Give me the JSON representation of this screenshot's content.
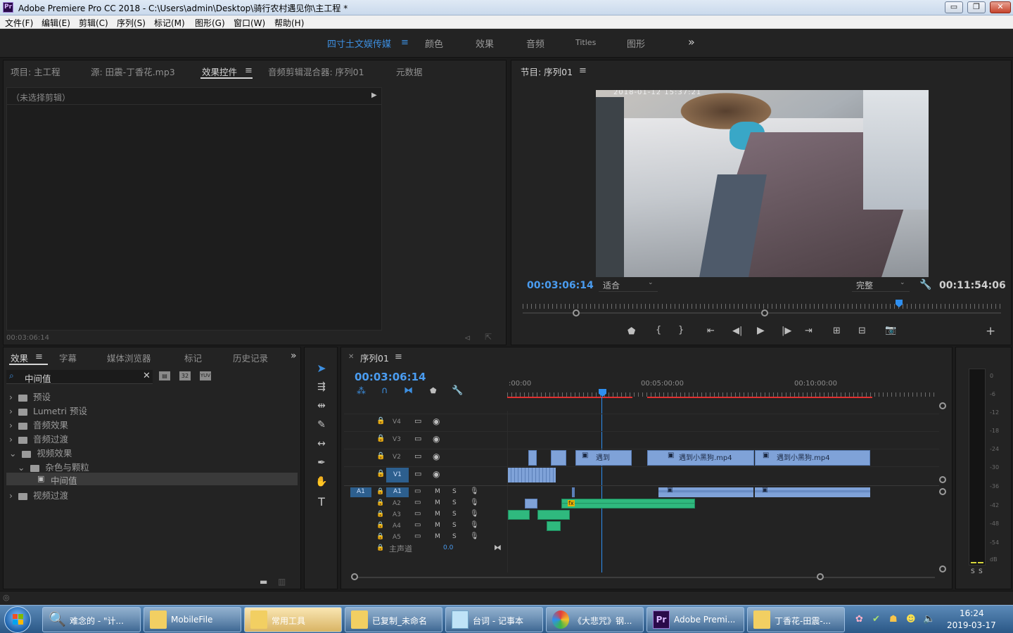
{
  "window": {
    "title": "Adobe Premiere Pro CC 2018 - C:\\Users\\admin\\Desktop\\骑行农村遇见你\\主工程 *",
    "app_icon": "Pr",
    "controls": {
      "minimize": "▭",
      "restore": "❐",
      "close": "✕"
    }
  },
  "menu": [
    "文件(F)",
    "编辑(E)",
    "剪辑(C)",
    "序列(S)",
    "标记(M)",
    "图形(G)",
    "窗口(W)",
    "帮助(H)"
  ],
  "workspaces": {
    "items": [
      "四寸土文娱传媒",
      "颜色",
      "效果",
      "音频",
      "Titles",
      "图形"
    ],
    "active_index": 0,
    "more": "»"
  },
  "source_panel": {
    "tabs": [
      "项目: 主工程",
      "源: 田震-丁香花.mp3",
      "效果控件",
      "音频剪辑混合器: 序列01",
      "元数据"
    ],
    "active_tab": "效果控件",
    "no_clip": "（未选择剪辑）",
    "timecode": "00:03:06:14"
  },
  "program_panel": {
    "title": "节目: 序列01",
    "video_timestamp": "2018-01-12 15:37:21",
    "timecode": "00:03:06:14",
    "fit_label": "适合",
    "quality_label": "完整",
    "duration": "00:11:54:06",
    "playhead_fraction": 0.78
  },
  "effects_panel": {
    "tabs": [
      "效果",
      "字幕",
      "媒体浏览器",
      "标记",
      "历史记录"
    ],
    "active_tab": "效果",
    "search_value": "中间值",
    "badges": [
      "32",
      "YUV"
    ],
    "tree": [
      {
        "label": "预设",
        "level": 0,
        "expanded": false
      },
      {
        "label": "Lumetri 预设",
        "level": 0,
        "expanded": false
      },
      {
        "label": "音频效果",
        "level": 0,
        "expanded": false
      },
      {
        "label": "音频过渡",
        "level": 0,
        "expanded": false
      },
      {
        "label": "视频效果",
        "level": 0,
        "expanded": true
      },
      {
        "label": "杂色与颗粒",
        "level": 1,
        "expanded": true
      },
      {
        "label": "中间值",
        "level": 2,
        "selected": true
      },
      {
        "label": "视频过渡",
        "level": 0,
        "expanded": false
      }
    ]
  },
  "timeline": {
    "sequence_name": "序列01",
    "timecode": "00:03:06:14",
    "ruler": [
      ":00:00",
      "00:05:00:00",
      "00:10:00:00"
    ],
    "video_tracks": [
      "V4",
      "V3",
      "V2",
      "V1"
    ],
    "audio_tracks": [
      "A1",
      "A2",
      "A3",
      "A4",
      "A5"
    ],
    "source_patch": "A1",
    "track_buttons": {
      "mute": "M",
      "solo": "S"
    },
    "master_label": "主声道",
    "master_value": "0.0",
    "clips": [
      {
        "label": "遇到",
        "track": "V2"
      },
      {
        "label": "遇到小黑狗.mp4",
        "track": "V2"
      },
      {
        "label": "遇到小黑狗.mp4",
        "track": "V2"
      }
    ],
    "fx_badge": "fx"
  },
  "meter": {
    "scale": [
      "0",
      "-6",
      "-12",
      "-18",
      "-24",
      "-30",
      "-36",
      "-42",
      "-48",
      "-54",
      "dB"
    ],
    "solo_labels": [
      "S",
      "S"
    ]
  },
  "taskbar": {
    "items": [
      "难念的 - \"计...",
      "MobileFile",
      "常用工具",
      "已复制_未命名",
      "台词 - 记事本",
      "《大悲咒》钢...",
      "Adobe Premi...",
      "丁香花-田震-..."
    ],
    "active_index": 2,
    "time": "16:24",
    "date": "2019-03-17"
  }
}
